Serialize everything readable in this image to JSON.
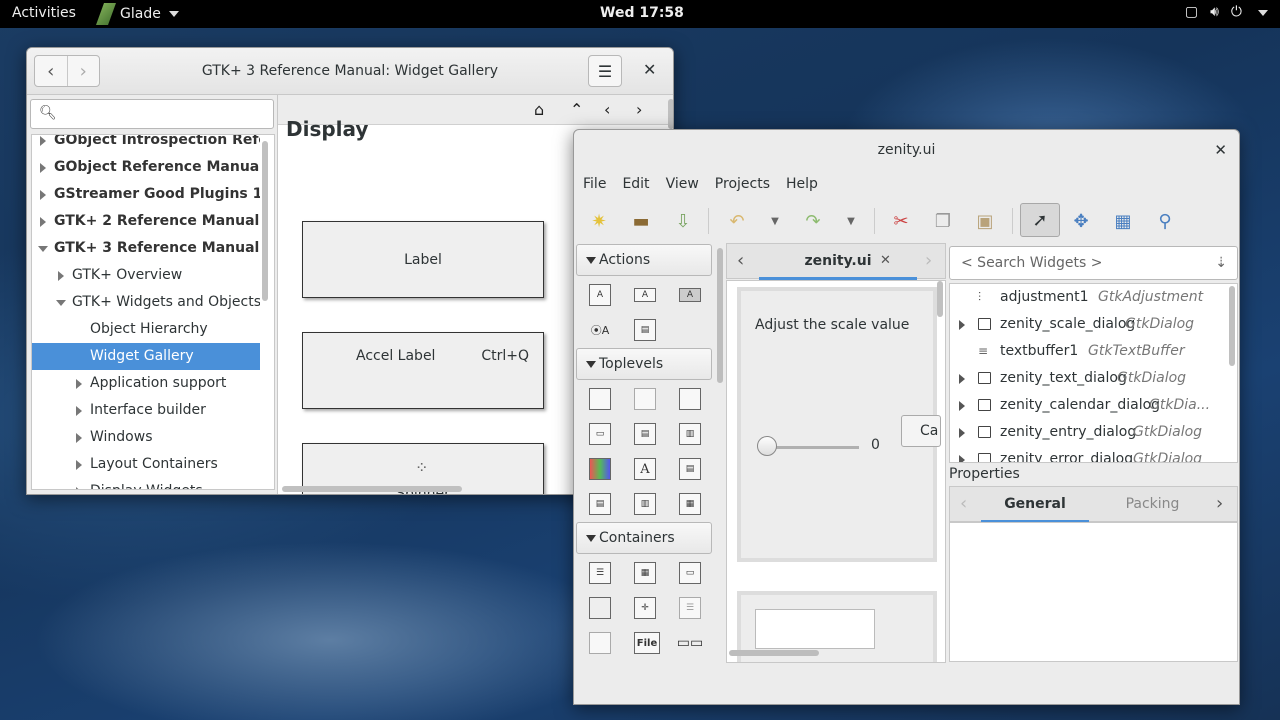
{
  "topbar": {
    "activities": "Activities",
    "app": "Glade",
    "clock": "Wed 17:58"
  },
  "help_window": {
    "title": "GTK+ 3 Reference Manual: Widget Gallery",
    "sidebar": [
      {
        "label": "GObject Introspection Refer...",
        "level": 0,
        "state": "collapsed"
      },
      {
        "label": "GObject Reference Manual",
        "level": 0,
        "state": "collapsed"
      },
      {
        "label": "GStreamer Good Plugins 1....",
        "level": 0,
        "state": "collapsed"
      },
      {
        "label": "GTK+ 2 Reference Manual",
        "level": 0,
        "state": "collapsed"
      },
      {
        "label": "GTK+ 3 Reference Manual",
        "level": 0,
        "state": "expanded"
      },
      {
        "label": "GTK+ Overview",
        "level": 1,
        "state": "collapsed"
      },
      {
        "label": "GTK+ Widgets and Objects",
        "level": 1,
        "state": "expanded"
      },
      {
        "label": "Object Hierarchy",
        "level": 2,
        "state": "leaf"
      },
      {
        "label": "Widget Gallery",
        "level": 2,
        "state": "selected"
      },
      {
        "label": "Application support",
        "level": 2,
        "state": "collapsed"
      },
      {
        "label": "Interface builder",
        "level": 2,
        "state": "collapsed"
      },
      {
        "label": "Windows",
        "level": 2,
        "state": "collapsed"
      },
      {
        "label": "Layout Containers",
        "level": 2,
        "state": "collapsed"
      },
      {
        "label": "Display Widgets",
        "level": 2,
        "state": "collapsed"
      }
    ],
    "content": {
      "heading": "Display",
      "widgets": [
        {
          "label": "Label",
          "accel": ""
        },
        {
          "label": "Accel Label",
          "accel": "Ctrl+Q"
        },
        {
          "label": "Spinner",
          "accel": ""
        }
      ]
    }
  },
  "glade_window": {
    "title": "zenity.ui",
    "menu": [
      "File",
      "Edit",
      "View",
      "Projects",
      "Help"
    ],
    "palette": {
      "groups": [
        "Actions",
        "Toplevels",
        "Containers"
      ]
    },
    "design": {
      "tab": "zenity.ui",
      "label": "Adjust the scale value",
      "scale_value": "0",
      "button_partial": "Ca"
    },
    "inspector": {
      "search_placeholder": "< Search Widgets >",
      "items": [
        {
          "name": "adjustment1",
          "type": "GtkAdjustment",
          "expandable": false
        },
        {
          "name": "zenity_scale_dialog",
          "type": "GtkDialog",
          "expandable": true
        },
        {
          "name": "textbuffer1",
          "type": "GtkTextBuffer",
          "expandable": false
        },
        {
          "name": "zenity_text_dialog",
          "type": "GtkDialog",
          "expandable": true
        },
        {
          "name": "zenity_calendar_dialog",
          "type": "GtkDia...",
          "expandable": true
        },
        {
          "name": "zenity_entry_dialog",
          "type": "GtkDialog",
          "expandable": true
        },
        {
          "name": "zenity_error_dialog",
          "type": "GtkDialog",
          "expandable": true
        }
      ]
    },
    "properties": {
      "label": "Properties",
      "tabs": [
        "General",
        "Packing"
      ]
    }
  }
}
